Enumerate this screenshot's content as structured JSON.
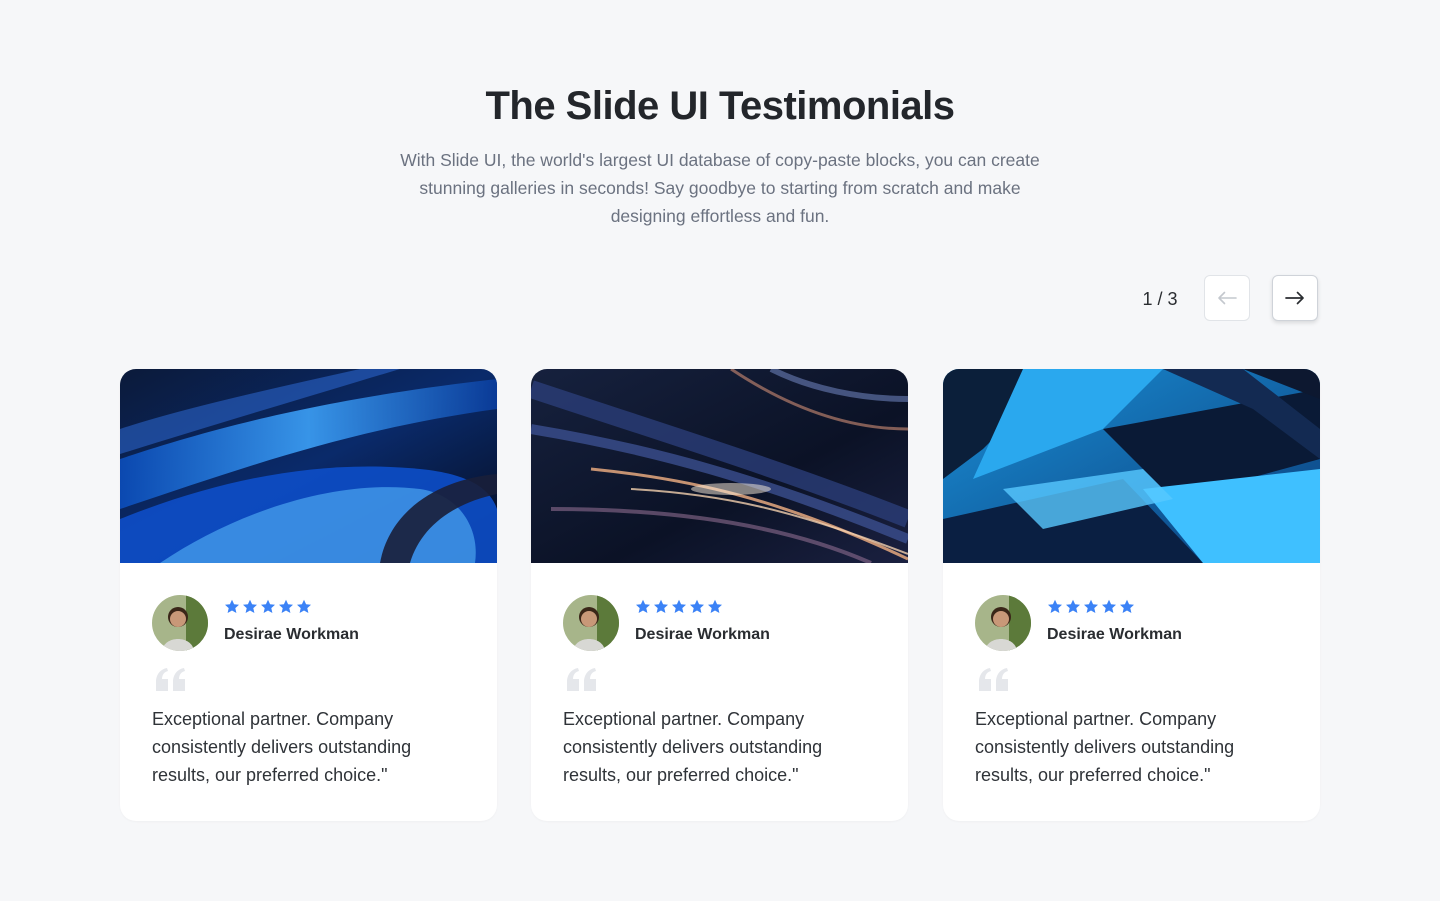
{
  "header": {
    "title": "The Slide UI Testimonials",
    "subtitle": "With Slide UI, the world's largest UI database of copy-paste blocks, you can create stunning galleries in seconds! Say goodbye to starting from scratch and make designing effortless and fun."
  },
  "pager": {
    "count_label": "1 / 3",
    "prev_icon": "arrow-left-icon",
    "next_icon": "arrow-right-icon"
  },
  "colors": {
    "star": "#3b82f6",
    "quote_icon": "#e5e7eb",
    "background": "#f6f7f9"
  },
  "testimonials": [
    {
      "rating": 5,
      "author": "Desirae Workman",
      "quote": "Exceptional partner. Company consistently delivers outstanding results, our preferred choice.\"",
      "image": "abstract-blue-waves"
    },
    {
      "rating": 5,
      "author": "Desirae Workman",
      "quote": "Exceptional partner. Company consistently delivers outstanding results, our preferred choice.\"",
      "image": "abstract-dark-streaks"
    },
    {
      "rating": 5,
      "author": "Desirae Workman",
      "quote": "Exceptional partner. Company consistently delivers outstanding results, our preferred choice.\"",
      "image": "abstract-blue-shards"
    }
  ]
}
